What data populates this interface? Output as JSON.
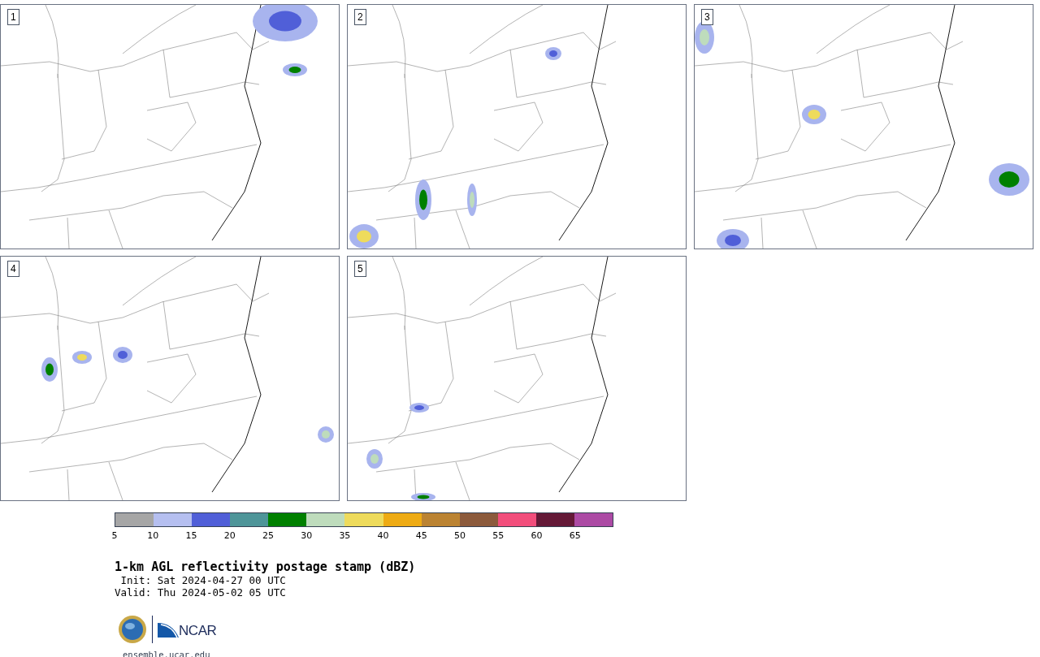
{
  "panels": [
    {
      "label": "1"
    },
    {
      "label": "2"
    },
    {
      "label": "3"
    },
    {
      "label": "4"
    },
    {
      "label": "5"
    }
  ],
  "colorbar": {
    "segments": [
      {
        "color": "#a6a6a6"
      },
      {
        "color": "#b5bff0"
      },
      {
        "color": "#505fd8"
      },
      {
        "color": "#4e9599"
      },
      {
        "color": "#008000"
      },
      {
        "color": "#bedcbc"
      },
      {
        "color": "#eedb5c"
      },
      {
        "color": "#eeab14"
      },
      {
        "color": "#bb8332"
      },
      {
        "color": "#8c5a3c"
      },
      {
        "color": "#f24e7c"
      },
      {
        "color": "#641937"
      },
      {
        "color": "#ac4aa4"
      }
    ],
    "tick_labels": [
      "5",
      "10",
      "15",
      "20",
      "25",
      "30",
      "35",
      "40",
      "45",
      "50",
      "55",
      "60",
      "65"
    ]
  },
  "title": "1-km AGL reflectivity postage stamp (dBZ)",
  "init": " Init: Sat 2024-04-27 00 UTC",
  "valid": "Valid: Thu 2024-05-02 05 UTC",
  "logo": {
    "text": "NCAR"
  },
  "url": "ensemble.ucar.edu"
}
